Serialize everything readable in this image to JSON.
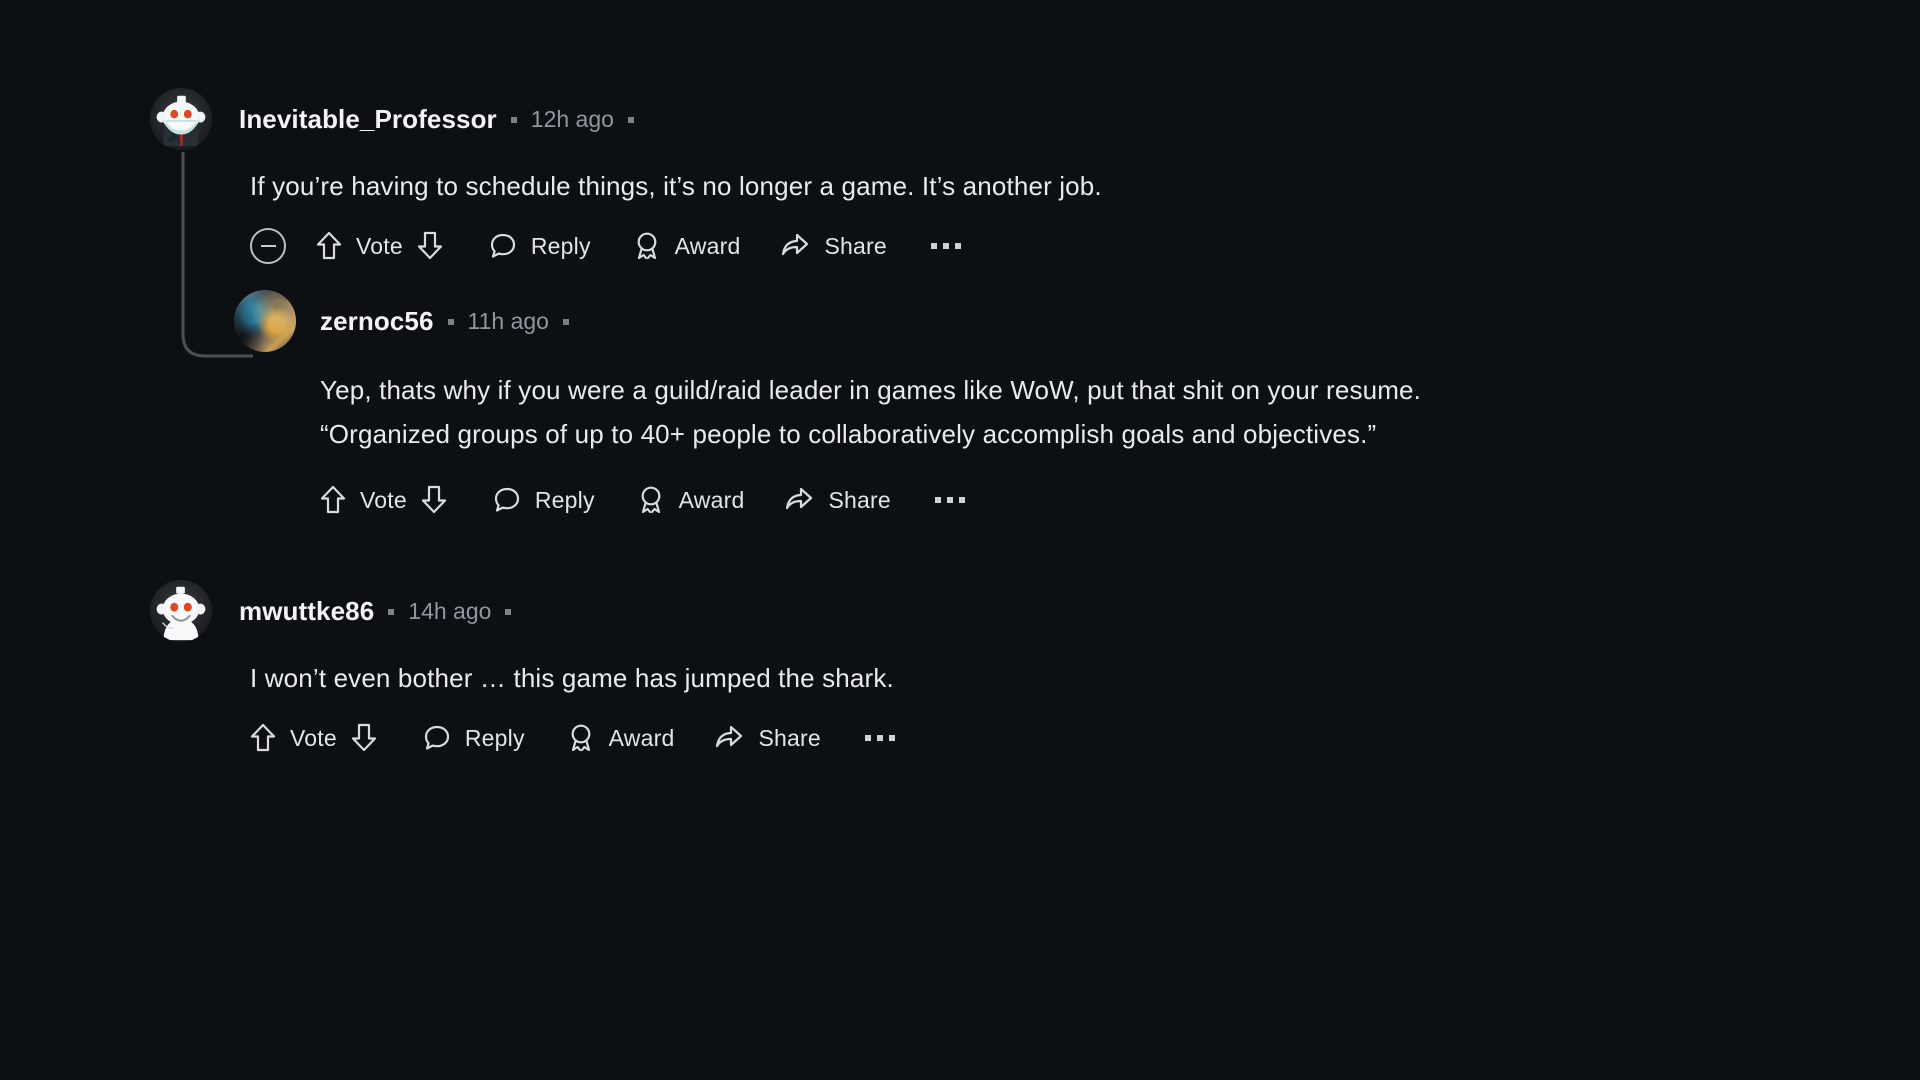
{
  "theme": {
    "background": "#0d1013",
    "text_primary": "#e8ebec",
    "text_muted": "#9097a0",
    "thread_line": "#4a5055",
    "snoo_eye": "#e2451f"
  },
  "comments": [
    {
      "id": "comment-1",
      "author": "Inevitable_Professor",
      "timestamp": "12h ago",
      "avatar": "snoo-masked-avatar",
      "body": [
        "If you’re having to schedule things, it’s no longer a game. It’s another job."
      ],
      "collapse_icon": "minus-circle-icon",
      "actions": {
        "vote_label": "Vote",
        "upvote_icon": "upvote-arrow-icon",
        "downvote_icon": "downvote-arrow-icon",
        "reply_label": "Reply",
        "reply_icon": "comment-bubble-icon",
        "award_label": "Award",
        "award_icon": "award-medal-icon",
        "share_label": "Share",
        "share_icon": "share-arrow-icon",
        "overflow_icon": "ellipsis-icon"
      }
    },
    {
      "id": "comment-2",
      "author": "zernoc56",
      "timestamp": "11h ago",
      "avatar": "custom-artwork-avatar",
      "body": [
        "Yep, thats why if you were a guild/raid leader in games like WoW, put that shit on your resume.",
        "“Organized groups of up to 40+ people to collaboratively accomplish goals and objectives.”"
      ],
      "actions": {
        "vote_label": "Vote",
        "upvote_icon": "upvote-arrow-icon",
        "downvote_icon": "downvote-arrow-icon",
        "reply_label": "Reply",
        "reply_icon": "comment-bubble-icon",
        "award_label": "Award",
        "award_icon": "award-medal-icon",
        "share_label": "Share",
        "share_icon": "share-arrow-icon",
        "overflow_icon": "ellipsis-icon"
      }
    },
    {
      "id": "comment-3",
      "author": "mwuttke86",
      "timestamp": "14h ago",
      "avatar": "snoo-default-avatar",
      "body": [
        "I won’t even bother … this game has jumped the shark."
      ],
      "actions": {
        "vote_label": "Vote",
        "upvote_icon": "upvote-arrow-icon",
        "downvote_icon": "downvote-arrow-icon",
        "reply_label": "Reply",
        "reply_icon": "comment-bubble-icon",
        "award_label": "Award",
        "award_icon": "award-medal-icon",
        "share_label": "Share",
        "share_icon": "share-arrow-icon",
        "overflow_icon": "ellipsis-icon"
      }
    }
  ]
}
